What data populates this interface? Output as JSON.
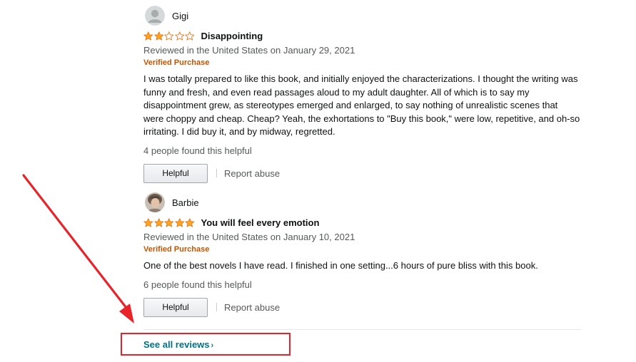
{
  "colors": {
    "star_fill": "#FFA41C",
    "star_empty_stroke": "#DE7921",
    "verified": "#C45500",
    "link": "#007185",
    "annotation": "#E8242A"
  },
  "reviews": [
    {
      "profile_name": "Gigi",
      "avatar_icon": "default-user-icon",
      "rating": 2,
      "rating_max": 5,
      "title": "Disappointing",
      "date": "Reviewed in the United States on January 29, 2021",
      "verified": "Verified Purchase",
      "body": "I was totally prepared to like this book, and initially enjoyed the characterizations. I thought the writing was funny and fresh, and even read passages aloud to my adult daughter. All of which is to say my disappointment grew, as stereotypes emerged and enlarged, to say nothing of unrealistic scenes that were choppy and cheap. Cheap? Yeah, the exhortations to \"Buy this book,\" were low, repetitive, and oh-so irritating. I did buy it, and by midway, regretted.",
      "helpful_count": "4 people found this helpful",
      "helpful_label": "Helpful",
      "report_label": "Report abuse"
    },
    {
      "profile_name": "Barbie",
      "avatar_icon": "user-photo",
      "rating": 5,
      "rating_max": 5,
      "title": "You will feel every emotion",
      "date": "Reviewed in the United States on January 10, 2021",
      "verified": "Verified Purchase",
      "body": "One of the best novels I have read. I finished in one setting...6 hours of pure bliss with this book.",
      "helpful_count": "6 people found this helpful",
      "helpful_label": "Helpful",
      "report_label": "Report abuse"
    }
  ],
  "see_all": {
    "label": "See all reviews",
    "chevron": "›"
  },
  "annotation": {
    "type": "red-arrow-and-box",
    "target": "see-all-reviews-link"
  }
}
